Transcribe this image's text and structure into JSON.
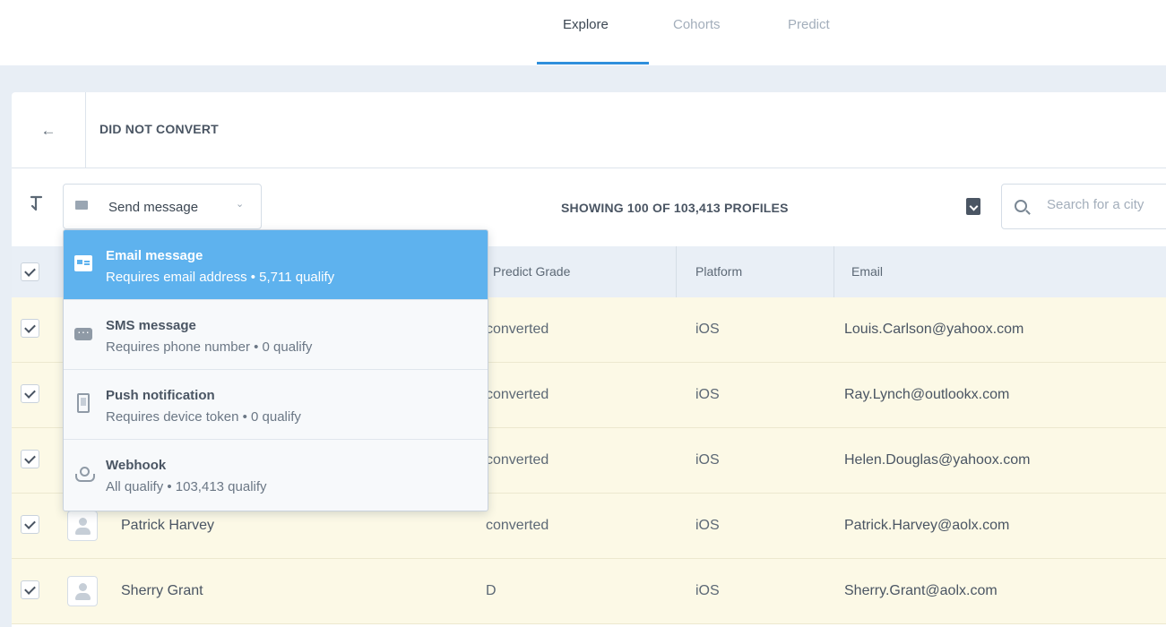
{
  "nav": {
    "tabs": [
      {
        "label": "Explore",
        "active": true
      },
      {
        "label": "Cohorts",
        "active": false
      },
      {
        "label": "Predict",
        "active": false
      }
    ]
  },
  "header": {
    "back_icon": "arrow-left-icon",
    "title": "DID NOT CONVERT"
  },
  "toolbar": {
    "send_label": "Send message",
    "showing_text": "SHOWING 100 OF 103,413 PROFILES",
    "search_placeholder": "Search for a city"
  },
  "table": {
    "columns": [
      "Predict Grade",
      "Platform",
      "Email"
    ],
    "rows": [
      {
        "name": "",
        "grade": "converted",
        "platform": "iOS",
        "email": "Louis.Carlson@yahoox.com"
      },
      {
        "name": "",
        "grade": "converted",
        "platform": "iOS",
        "email": "Ray.Lynch@outlookx.com"
      },
      {
        "name": "",
        "grade": "converted",
        "platform": "iOS",
        "email": "Helen.Douglas@yahoox.com"
      },
      {
        "name": "Patrick Harvey",
        "grade": "converted",
        "platform": "iOS",
        "email": "Patrick.Harvey@aolx.com"
      },
      {
        "name": "Sherry Grant",
        "grade": "D",
        "platform": "iOS",
        "email": "Sherry.Grant@aolx.com"
      }
    ]
  },
  "dropdown": {
    "items": [
      {
        "title": "Email message",
        "subtitle": "Requires email address • 5,711 qualify",
        "icon": "email-icon",
        "selected": true
      },
      {
        "title": "SMS message",
        "subtitle": "Requires phone number • 0 qualify",
        "icon": "sms-icon",
        "selected": false
      },
      {
        "title": "Push notification",
        "subtitle": "Requires device token • 0 qualify",
        "icon": "push-icon",
        "selected": false
      },
      {
        "title": "Webhook",
        "subtitle": "All qualify • 103,413 qualify",
        "icon": "webhook-icon",
        "selected": false
      }
    ]
  },
  "colors": {
    "accent": "#2f8fdc",
    "selected_item": "#5eb2ee",
    "row_highlight": "#fcf9e6",
    "header_bg": "#e9eff6"
  }
}
